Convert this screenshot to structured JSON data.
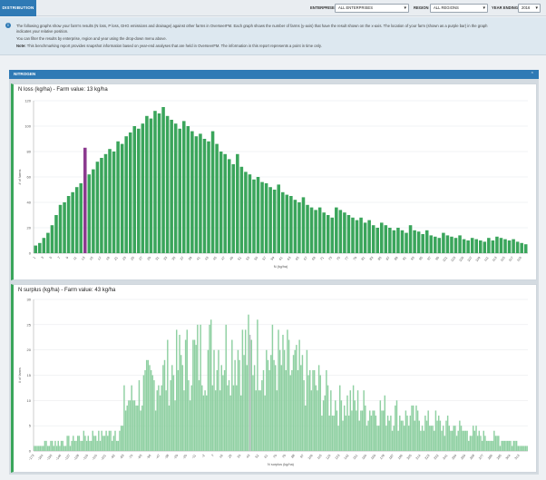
{
  "tabs": {
    "active_label": "DISTRIBUTION"
  },
  "filters": {
    "enterprise_label": "ENTERPRISE",
    "enterprise_value": "ALL ENTERPRISES",
    "region_label": "REGION",
    "region_value": "ALL REGIONS",
    "year_label": "YEAR ENDING",
    "year_value": "2016"
  },
  "intro": {
    "line1": "The following graphs show your farm's results (N loss, P loss, GHG emissions and drainage) against other farms in OverseerFM. Each graph shows the number of farms (y-axis) that have the result shown on the x-axis. The location of your farm (shown as a purple bar) in the graph",
    "line2": "indicates your relative position.",
    "line3": "You can filter the results by enterprise, region and year using the drop-down menu above.",
    "note_label": "Note:",
    "note_text": "This benchmarking report provides snapshot information based on year-end analyses that are held in OverseerFM. The information in this report represents a point in time only."
  },
  "section": {
    "title": "NITROGEN"
  },
  "chart_data": [
    {
      "type": "bar",
      "title": "N loss (kg/ha) - Farm value: 13 kg/ha",
      "xlabel": "N (kg/ha)",
      "ylabel": "# of farms",
      "ylim": [
        0,
        120
      ],
      "yticks": [
        0,
        20,
        40,
        60,
        80,
        100,
        120
      ],
      "x_start": 1,
      "x_step": 1,
      "x_tick_every": 2,
      "highlight_x": 13,
      "colors": {
        "bar": "#3aa55b",
        "highlight": "#8b3a8f"
      },
      "values": [
        6,
        8,
        12,
        16,
        22,
        30,
        38,
        40,
        45,
        48,
        52,
        55,
        83,
        62,
        66,
        72,
        75,
        78,
        82,
        80,
        88,
        86,
        92,
        95,
        100,
        98,
        102,
        108,
        106,
        112,
        110,
        115,
        108,
        105,
        102,
        98,
        104,
        100,
        96,
        92,
        94,
        90,
        88,
        96,
        86,
        80,
        78,
        74,
        70,
        78,
        68,
        64,
        62,
        58,
        60,
        56,
        55,
        52,
        50,
        54,
        48,
        46,
        45,
        42,
        40,
        44,
        38,
        36,
        34,
        36,
        32,
        30,
        28,
        36,
        34,
        32,
        30,
        28,
        26,
        28,
        24,
        26,
        22,
        20,
        24,
        22,
        20,
        18,
        20,
        18,
        16,
        22,
        18,
        17,
        15,
        18,
        14,
        13,
        12,
        16,
        14,
        13,
        12,
        14,
        11,
        10,
        12,
        11,
        10,
        9,
        12,
        10,
        13,
        12,
        11,
        10,
        11,
        9,
        8,
        7
      ]
    },
    {
      "type": "bar",
      "title": "N surplus (kg/ha) - Farm value: 43 kg/ha",
      "xlabel": "N surplus (kg/ha)",
      "ylabel": "# of farms",
      "ylim": [
        0,
        30
      ],
      "yticks": [
        0,
        5,
        10,
        15,
        20,
        25,
        30
      ],
      "x_start": -173,
      "x_step": 1.5,
      "x_tick_every": 6,
      "highlight_x": 43,
      "colors": {
        "bar": "#8fd0a2",
        "highlight": "#b9bdc1"
      }
    }
  ]
}
